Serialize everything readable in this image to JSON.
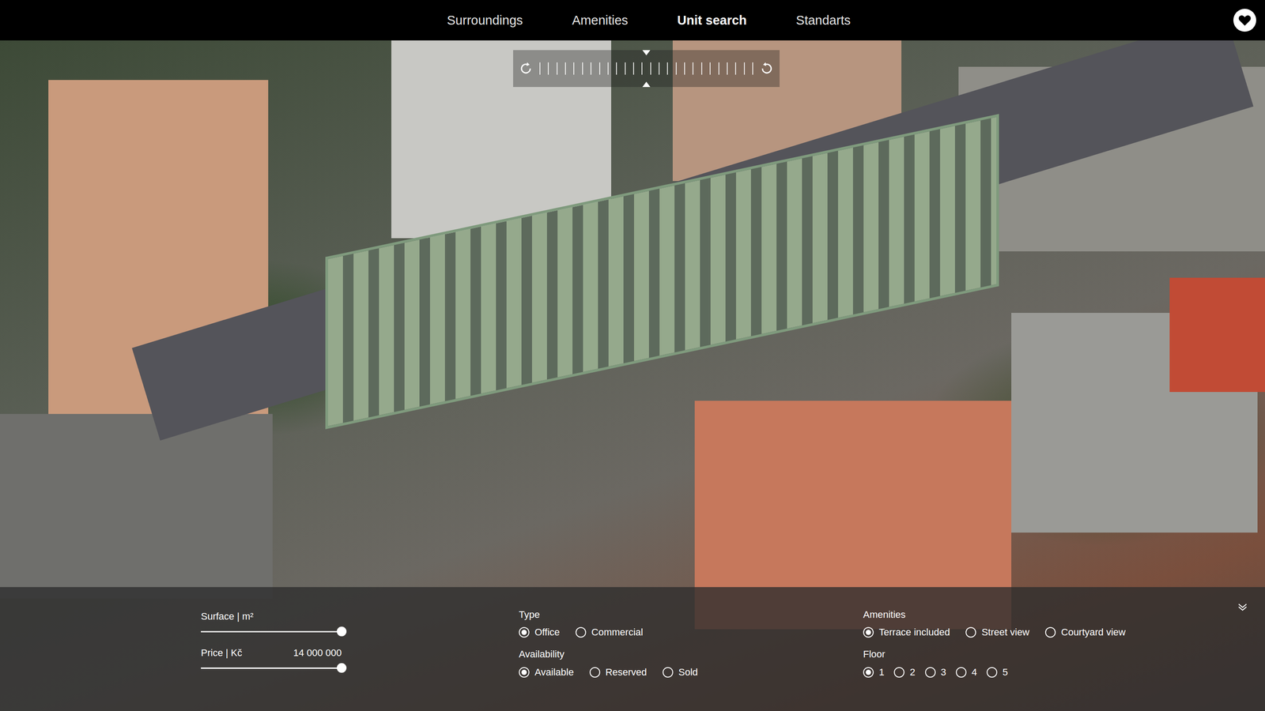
{
  "nav": {
    "tabs": [
      {
        "label": "Surroundings",
        "selected": false
      },
      {
        "label": "Amenities",
        "selected": false
      },
      {
        "label": "Unit search",
        "selected": true
      },
      {
        "label": "Standarts",
        "selected": false
      }
    ]
  },
  "rotation": {
    "level": 0.5
  },
  "filters": {
    "surface": {
      "label": "Surface | m²",
      "level": 1
    },
    "price": {
      "label": "Price | Kč",
      "value": "14 000 000",
      "level": 1
    },
    "type": {
      "label": "Type",
      "options": [
        {
          "label": "Office",
          "selected": true
        },
        {
          "label": "Commercial",
          "selected": false
        }
      ]
    },
    "availability": {
      "label": "Availability",
      "options": [
        {
          "label": "Available",
          "selected": true
        },
        {
          "label": "Reserved",
          "selected": false
        },
        {
          "label": "Sold",
          "selected": false
        }
      ]
    },
    "amenities": {
      "label": "Amenities",
      "options": [
        {
          "label": "Terrace included",
          "selected": true
        },
        {
          "label": "Street view",
          "selected": false
        },
        {
          "label": "Courtyard view",
          "selected": false
        }
      ]
    },
    "floor": {
      "label": "Floor",
      "options": [
        {
          "label": "1",
          "selected": true
        },
        {
          "label": "2",
          "selected": false
        },
        {
          "label": "3",
          "selected": false
        },
        {
          "label": "4",
          "selected": false
        },
        {
          "label": "5",
          "selected": false
        }
      ]
    }
  }
}
